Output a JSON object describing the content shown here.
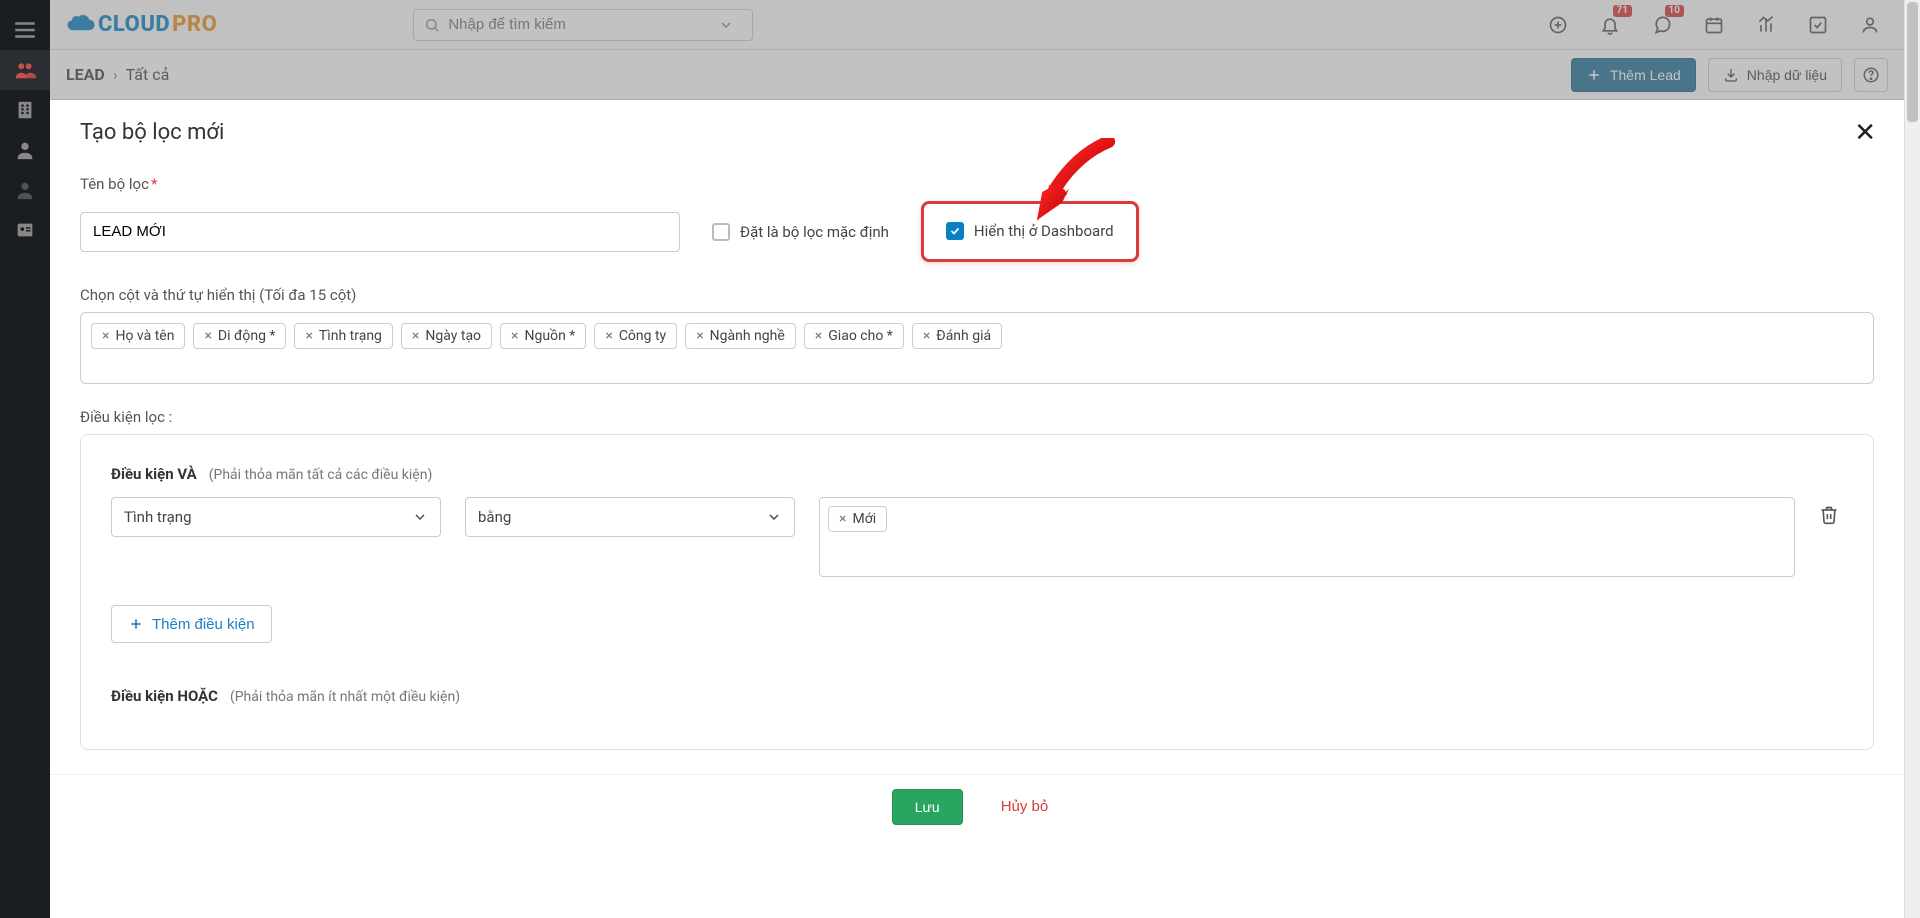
{
  "brand": {
    "name_a": "CLOUD",
    "name_b": "PRO"
  },
  "topbar": {
    "search_placeholder": "Nhập để tìm kiếm",
    "bell_badge": "71",
    "chat_badge": "10"
  },
  "subbar": {
    "crumb_module": "LEAD",
    "crumb_tail": "Tất cả",
    "add_lead": "Thêm Lead",
    "import": "Nhập dữ liệu"
  },
  "modal": {
    "title": "Tạo bộ lọc mới",
    "name_label": "Tên bộ lọc",
    "name_value": "LEAD MỚI",
    "default_label": "Đặt là bộ lọc mặc định",
    "dashboard_label": "Hiển thị ở Dashboard",
    "columns_label": "Chọn cột và thứ tự hiển thị (Tối đa 15 cột)",
    "columns": [
      "Họ và tên",
      "Di động *",
      "Tình trạng",
      "Ngày tạo",
      "Nguồn *",
      "Công ty",
      "Ngành nghề",
      "Giao cho *",
      "Đánh giá"
    ],
    "condition_label": "Điều kiện lọc :",
    "and": {
      "title": "Điều kiện VÀ",
      "hint": "(Phải thỏa mãn tất cả các điều kiện)",
      "rows": [
        {
          "field": "Tình trạng",
          "op": "bằng",
          "value": "Mới"
        }
      ],
      "add": "Thêm điều kiện"
    },
    "or": {
      "title": "Điều kiện HOẶC",
      "hint": "(Phải thỏa mãn ít nhất một điều kiện)"
    },
    "save": "Lưu",
    "cancel": "Hủy bỏ"
  }
}
